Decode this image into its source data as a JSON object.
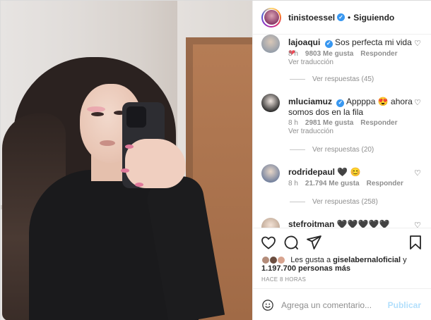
{
  "post": {
    "author": "tinistoessel",
    "separator": "•",
    "follow_label": "Siguiendo"
  },
  "comments": [
    {
      "user": "lajoaqui",
      "text": "Sos perfecta mi vida",
      "emoji": "❤",
      "age": "8 h",
      "likes": "9803 Me gusta",
      "reply": "Responder",
      "translate": "Ver traducción",
      "replies": "Ver respuestas (45)"
    },
    {
      "user": "mluciamuz",
      "text": "Appppa",
      "emoji": "😍",
      "text2": "ahora somos dos en la fila",
      "age": "8 h",
      "likes": "2981 Me gusta",
      "reply": "Responder",
      "translate": "Ver traducción",
      "replies": "Ver respuestas (20)"
    },
    {
      "user": "rodridepaul",
      "text": "🖤",
      "emoji": "😊",
      "age": "8 h",
      "likes": "21.794 Me gusta",
      "reply": "Responder",
      "replies": "Ver respuestas (258)"
    },
    {
      "user": "stefroitman",
      "text": "🖤🖤🖤🖤🖤"
    }
  ],
  "likes": {
    "prefix": "Les gusta a",
    "user": "giselabernaloficial",
    "conj": "y",
    "count": "1.197.700 personas más"
  },
  "timestamp": "HACE 8 HORAS",
  "add_comment": {
    "placeholder": "Agrega un comentario...",
    "publish": "Publicar"
  },
  "icons": {
    "verified": "verified-badge",
    "heart": "heart-icon",
    "comment": "comment-icon",
    "share": "share-icon",
    "save": "bookmark-icon",
    "emoji": "emoji-icon"
  },
  "colors": {
    "verified": "#3897f0",
    "muted": "#8e8e8e",
    "publish": "#b2dffc",
    "heart_red": "#ed4956"
  }
}
